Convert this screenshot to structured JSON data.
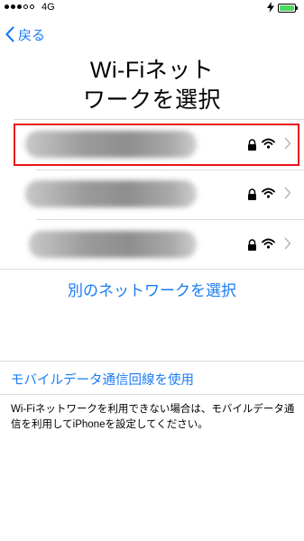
{
  "status_bar": {
    "carrier": "4G",
    "signal_bars_filled": 3,
    "signal_bars_total": 5,
    "battery_color": "#4cd964"
  },
  "nav": {
    "back_label": "戻る",
    "accent_color": "#1a7cf5"
  },
  "title": {
    "line1": "Wi-Fiネット",
    "line2": "ワークを選択"
  },
  "networks": [
    {
      "name_redacted": true,
      "secured": true,
      "icons": [
        "lock-icon",
        "wifi-icon",
        "chevron-right-icon"
      ],
      "highlighted": true
    },
    {
      "name_redacted": true,
      "secured": true,
      "icons": [
        "lock-icon",
        "wifi-icon",
        "chevron-right-icon"
      ],
      "highlighted": false
    },
    {
      "name_redacted": true,
      "secured": true,
      "icons": [
        "lock-icon",
        "wifi-icon",
        "chevron-right-icon"
      ],
      "highlighted": false
    }
  ],
  "other_network_label": "別のネットワークを選択",
  "cellular": {
    "link_label": "モバイルデータ通信回線を使用",
    "note": "Wi-Fiネットワークを利用できない場合は、モバイルデータ通信を利用してiPhoneを設定してください。"
  },
  "highlight_color": "#e8141c"
}
